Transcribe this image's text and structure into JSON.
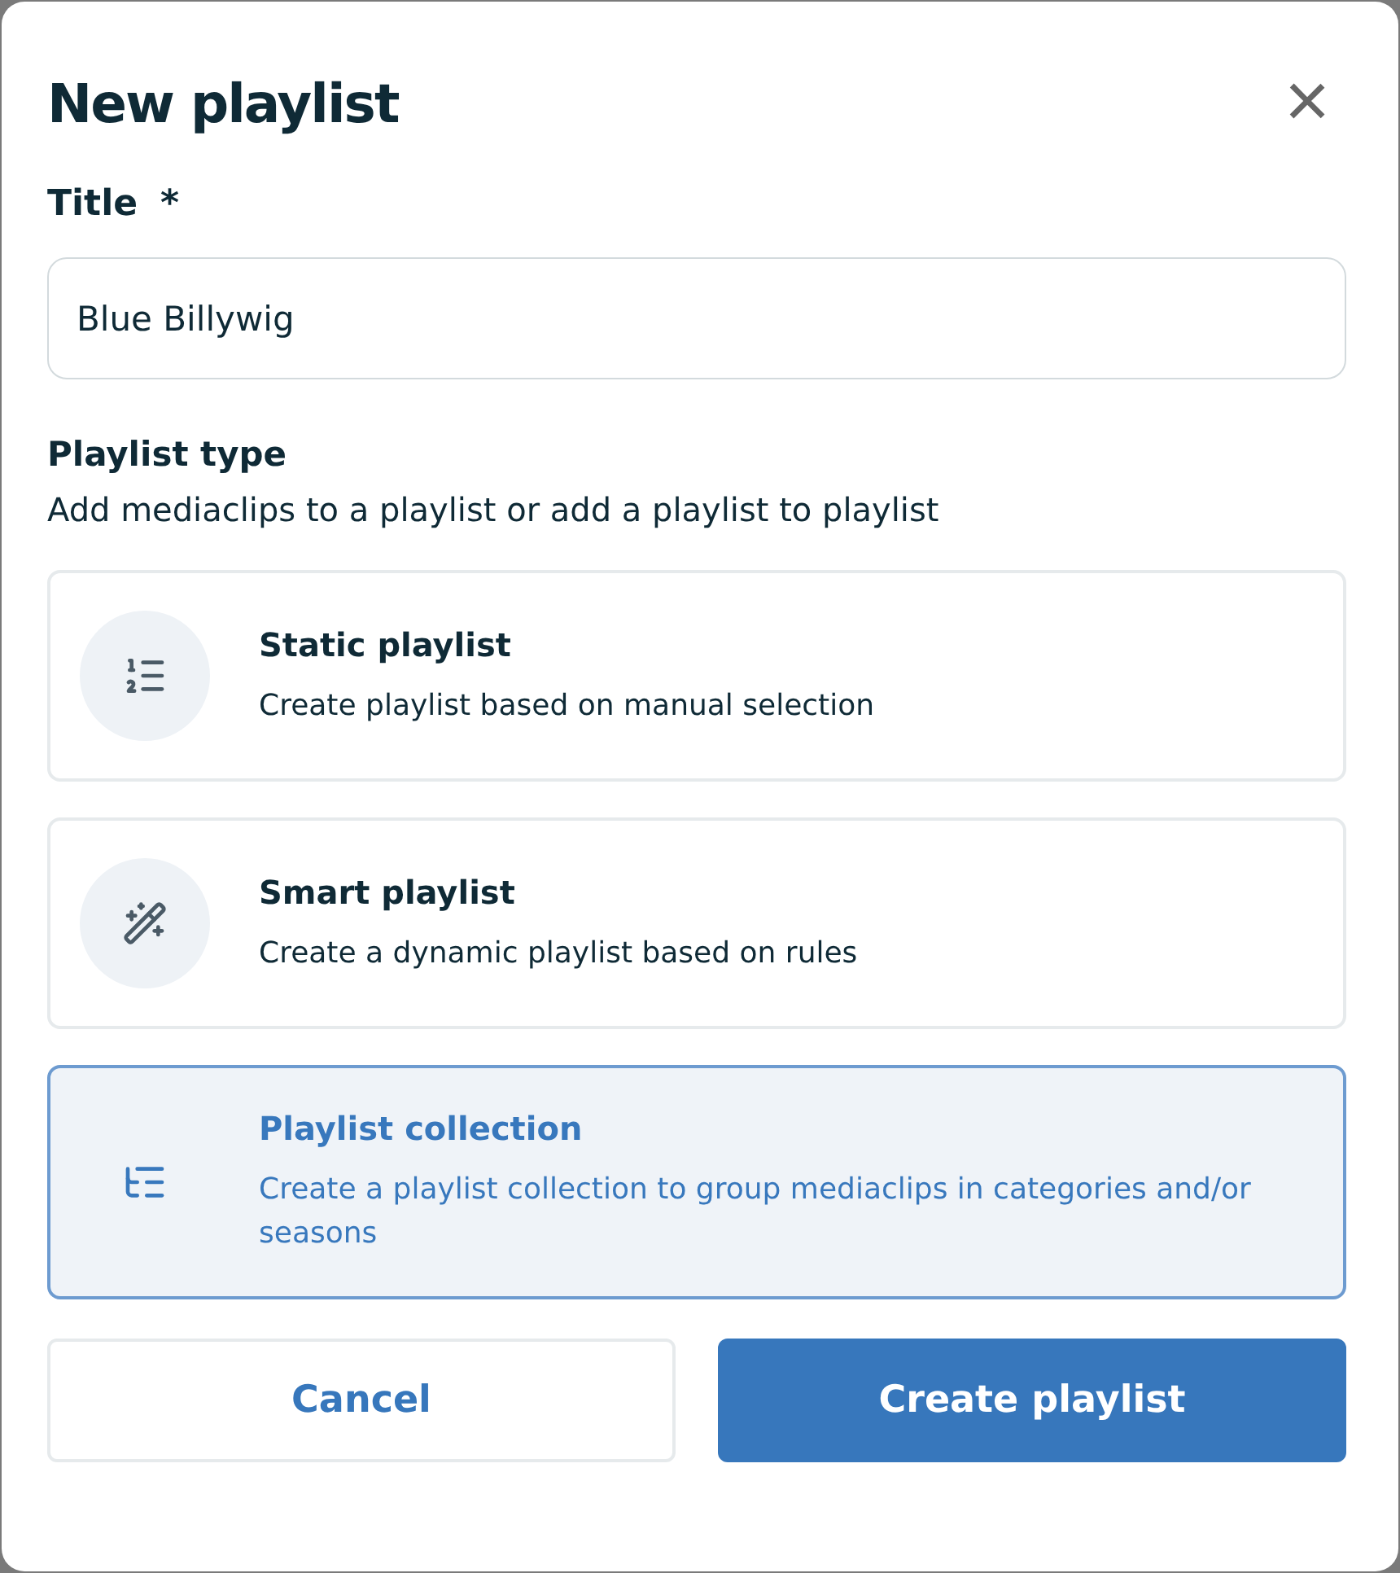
{
  "dialog": {
    "title": "New playlist",
    "close": "×"
  },
  "title_field": {
    "label": "Title",
    "required_mark": "*",
    "value": "Blue Billywig"
  },
  "playlist_type": {
    "label": "Playlist type",
    "description": "Add mediaclips to a playlist or add a playlist to playlist",
    "options": [
      {
        "kind": "static",
        "title": "Static playlist",
        "description": "Create playlist based on manual selection",
        "selected": false
      },
      {
        "kind": "smart",
        "title": "Smart playlist",
        "description": "Create a dynamic playlist based on rules",
        "selected": false
      },
      {
        "kind": "collection",
        "title": "Playlist collection",
        "description": "Create a playlist collection to group mediaclips in categories and/or seasons",
        "selected": true
      }
    ]
  },
  "buttons": {
    "cancel": "Cancel",
    "submit": "Create playlist"
  }
}
